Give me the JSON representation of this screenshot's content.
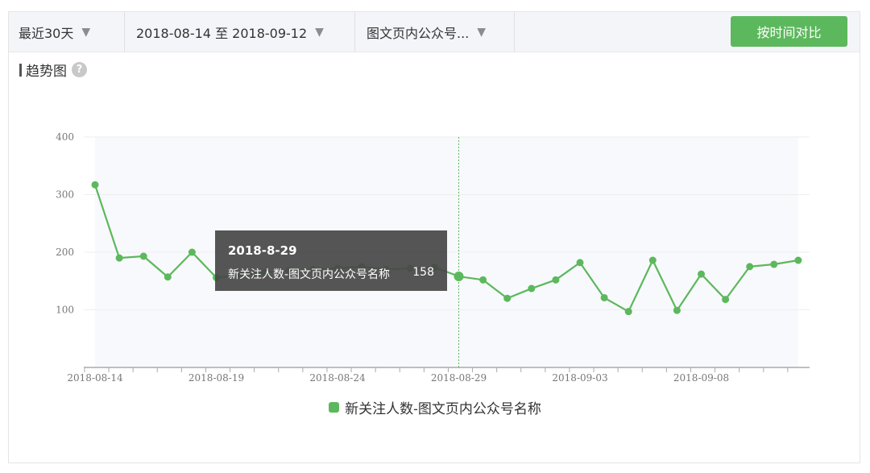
{
  "toolbar": {
    "range_label": "最近30天",
    "date_range": "2018-08-14 至 2018-09-12",
    "source_label": "图文页内公众号...",
    "compare_button": "按时间对比",
    "arrow": "▼"
  },
  "section": {
    "title": "趋势图",
    "help": "?"
  },
  "tooltip": {
    "date": "2018-8-29",
    "series": "新关注人数-图文页内公众号名称",
    "value": "158"
  },
  "colors": {
    "line": "#5cb85c",
    "accent": "#5cb85c"
  },
  "chart_data": {
    "type": "line",
    "ylim": [
      0,
      400
    ],
    "yticks": [
      100,
      200,
      300,
      400
    ],
    "xtick_labels": [
      "2018-08-14",
      "2018-08-19",
      "2018-08-24",
      "2018-08-29",
      "2018-09-03",
      "2018-09-08"
    ],
    "grid": true,
    "legend_position": "bottom-center",
    "highlight_x": "2018-08-29",
    "x": [
      "2018-08-14",
      "2018-08-15",
      "2018-08-16",
      "2018-08-17",
      "2018-08-18",
      "2018-08-19",
      "2018-08-20",
      "2018-08-21",
      "2018-08-22",
      "2018-08-23",
      "2018-08-24",
      "2018-08-25",
      "2018-08-26",
      "2018-08-27",
      "2018-08-28",
      "2018-08-29",
      "2018-08-30",
      "2018-08-31",
      "2018-09-01",
      "2018-09-02",
      "2018-09-03",
      "2018-09-04",
      "2018-09-05",
      "2018-09-06",
      "2018-09-07",
      "2018-09-08",
      "2018-09-09",
      "2018-09-10",
      "2018-09-11",
      "2018-09-12"
    ],
    "series": [
      {
        "name": "新关注人数-图文页内公众号名称",
        "values": [
          317,
          190,
          193,
          157,
          200,
          156,
          160,
          165,
          168,
          170,
          172,
          175,
          170,
          172,
          174,
          158,
          152,
          120,
          137,
          152,
          182,
          121,
          97,
          186,
          99,
          162,
          118,
          175,
          179,
          186
        ]
      }
    ]
  }
}
